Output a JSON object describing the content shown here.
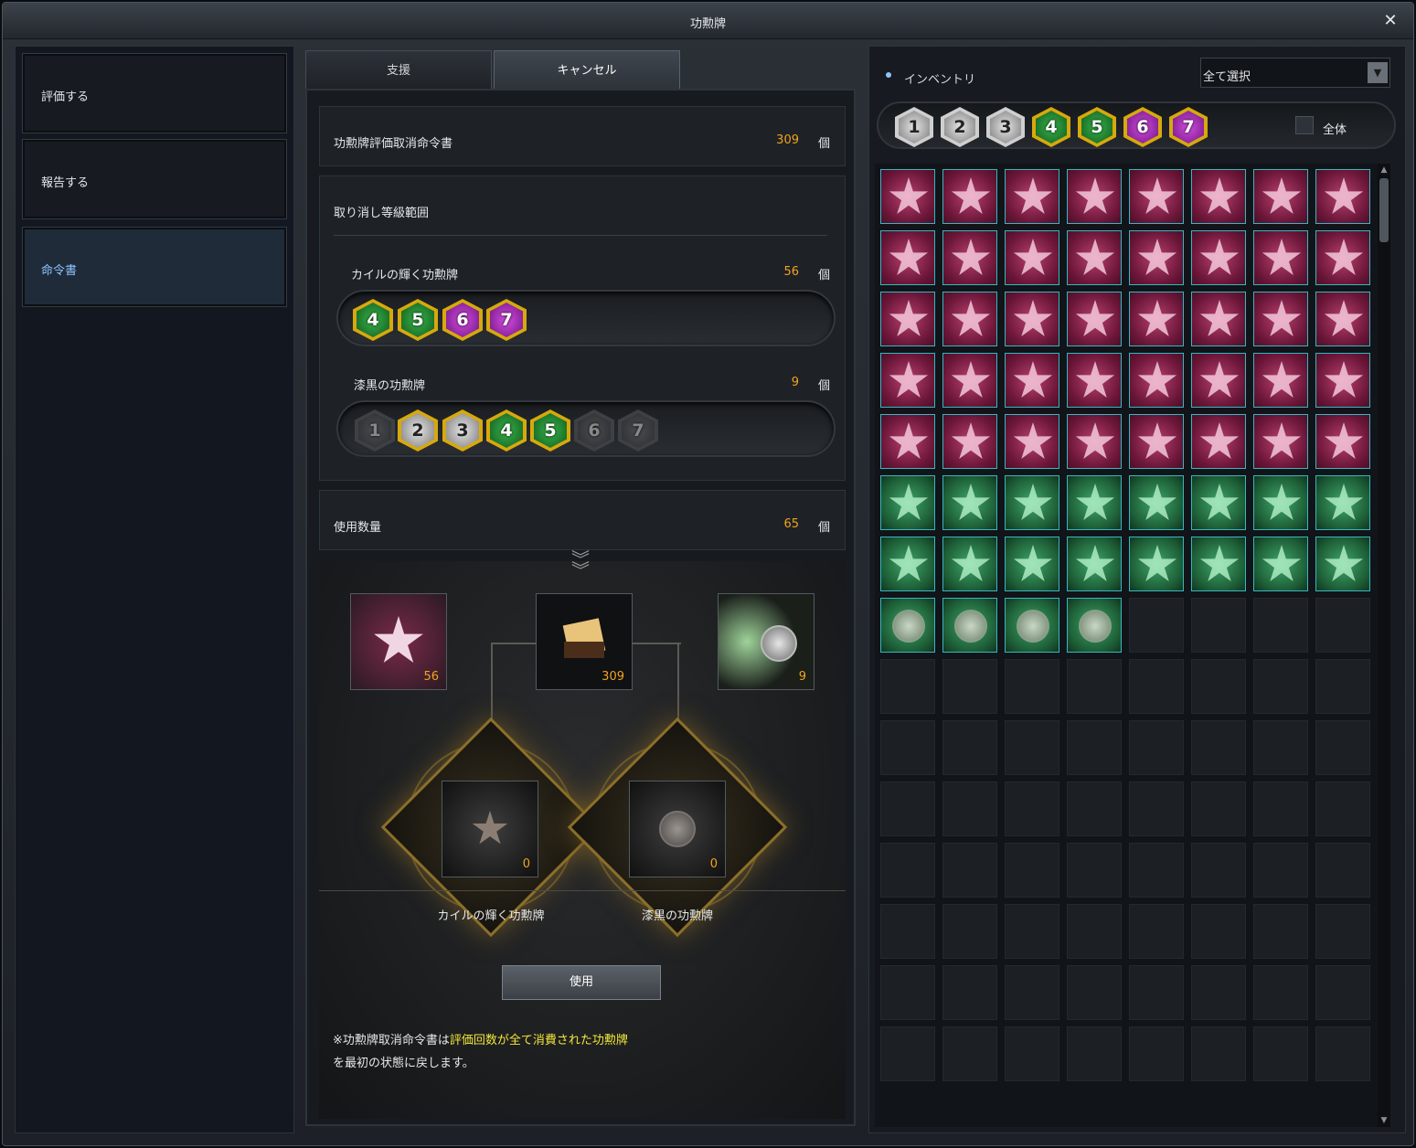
{
  "window": {
    "title": "功勲牌",
    "close_label": "✕"
  },
  "leftnav": {
    "items": [
      {
        "label": "評価する"
      },
      {
        "label": "報告する"
      },
      {
        "label": "命令書"
      }
    ]
  },
  "tabs": {
    "support": "支援",
    "cancel": "キャンセル"
  },
  "scroll_row": {
    "label": "功勲牌評価取消命令書",
    "count": "309",
    "unit": "個"
  },
  "range": {
    "title": "取り消し等級範囲",
    "kail": {
      "label": "カイルの輝く功勲牌",
      "count": "56",
      "unit": "個",
      "grades": [
        "4",
        "5",
        "6",
        "7"
      ]
    },
    "black": {
      "label": "漆黒の功勲牌",
      "count": "9",
      "unit": "個",
      "grades": [
        "1",
        "2",
        "3",
        "4",
        "5",
        "6",
        "7"
      ]
    }
  },
  "usage": {
    "label": "使用数量",
    "count": "65",
    "unit": "個"
  },
  "stage": {
    "slot_kail": "56",
    "slot_scroll": "309",
    "slot_black": "9",
    "result_kail": {
      "count": "0",
      "label": "カイルの輝く功勲牌"
    },
    "result_black": {
      "count": "0",
      "label": "漆黒の功勲牌"
    },
    "use_button": "使用"
  },
  "note": {
    "line1_a": "※功勲牌取消命令書は",
    "line1_b": "評価回数が全て消費された功勲牌",
    "line2": "を最初の状態に戻します。"
  },
  "inventory": {
    "title": "インベントリ",
    "select_value": "全て選択",
    "grades": [
      "1",
      "2",
      "3",
      "4",
      "5",
      "6",
      "7"
    ],
    "all_label": "全体",
    "items_pink": 40,
    "items_green": 16,
    "items_coin": 4,
    "rows": 15,
    "cols": 8
  },
  "colors": {
    "accent_orange": "#f2a21b",
    "highlight_yellow": "#f3e83a",
    "active_blue": "#8fc3ff"
  }
}
